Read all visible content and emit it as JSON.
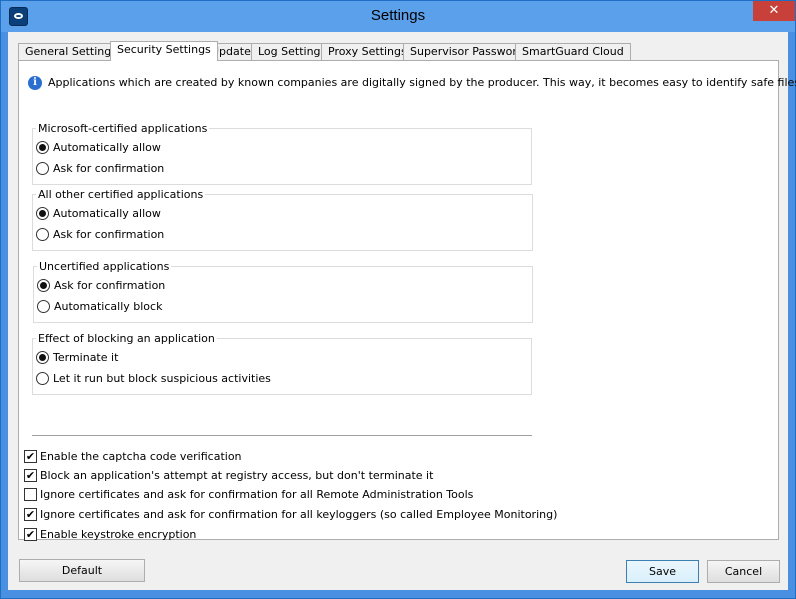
{
  "window": {
    "title": "Settings",
    "close_glyph": "✕",
    "app_icon": "app-eye-icon"
  },
  "tabs": [
    {
      "label": "General Settings",
      "active": false
    },
    {
      "label": "Security Settings",
      "active": true
    },
    {
      "label": "Update",
      "active": false
    },
    {
      "label": "Log Settings",
      "active": false
    },
    {
      "label": "Proxy Settings",
      "active": false
    },
    {
      "label": "Supervisor Password",
      "active": false
    },
    {
      "label": "SmartGuard Cloud",
      "active": false
    }
  ],
  "info": {
    "icon": "info-icon",
    "glyph": "i",
    "text": "Applications which are created by known companies are digitally signed by the producer. This way, it becomes easy to identify safe files."
  },
  "groups": [
    {
      "title": "Microsoft-certified applications",
      "options": [
        {
          "label": "Automatically allow",
          "selected": true
        },
        {
          "label": "Ask for confirmation",
          "selected": false
        }
      ]
    },
    {
      "title": "All other certified applications",
      "options": [
        {
          "label": "Automatically allow",
          "selected": true
        },
        {
          "label": "Ask for confirmation",
          "selected": false
        }
      ]
    },
    {
      "title": "Uncertified applications",
      "options": [
        {
          "label": "Ask for confirmation",
          "selected": true
        },
        {
          "label": "Automatically block",
          "selected": false
        }
      ]
    },
    {
      "title": "Effect of blocking an application",
      "options": [
        {
          "label": "Terminate it",
          "selected": true
        },
        {
          "label": "Let it run but block suspicious activities",
          "selected": false
        }
      ]
    }
  ],
  "checkboxes": [
    {
      "label": "Enable the captcha code verification",
      "checked": true
    },
    {
      "label": "Block an application's attempt at registry access, but don't terminate it",
      "checked": true
    },
    {
      "label": "Ignore certificates and ask for confirmation for all Remote Administration Tools",
      "checked": false
    },
    {
      "label": "Ignore certificates and ask for confirmation for all keyloggers (so called Employee Monitoring)",
      "checked": true
    },
    {
      "label": "Enable keystroke encryption",
      "checked": true
    }
  ],
  "check_glyph": "✔",
  "buttons": {
    "default": "Default",
    "save": "Save",
    "cancel": "Cancel"
  }
}
